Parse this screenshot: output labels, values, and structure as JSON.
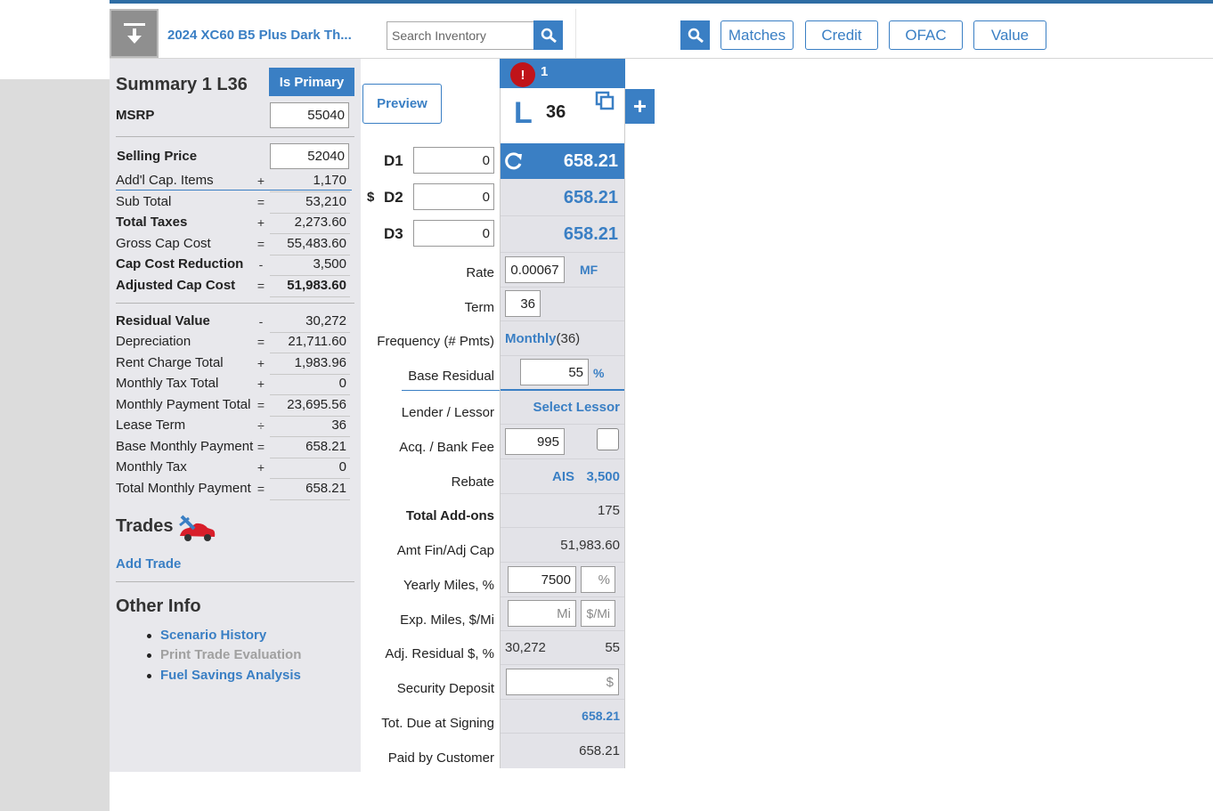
{
  "header": {
    "title": "2024 XC60 B5 Plus Dark Th...",
    "search_placeholder": "Search Inventory",
    "buttons": {
      "matches": "Matches",
      "credit": "Credit",
      "ofac": "OFAC",
      "value": "Value"
    }
  },
  "summary": {
    "title": "Summary 1 L36",
    "is_primary": "Is Primary",
    "msrp_label": "MSRP",
    "msrp_value": "55040",
    "selling_price_label": "Selling Price",
    "selling_price_value": "52040",
    "rows": [
      {
        "label": "Add'l Cap. Items",
        "op": "+",
        "value": "1,170",
        "link": false
      },
      {
        "label": "Sub Total",
        "op": "=",
        "value": "53,210",
        "link": false
      },
      {
        "label": "Total Taxes",
        "op": "+",
        "value": "2,273.60",
        "link": true
      },
      {
        "label": "Gross Cap Cost",
        "op": "=",
        "value": "55,483.60",
        "link": false
      },
      {
        "label": "Cap Cost Reduction",
        "op": "-",
        "value": "3,500",
        "link": true
      },
      {
        "label": "Adjusted Cap Cost",
        "op": "=",
        "value": "51,983.60",
        "link": true
      },
      {
        "label": "Residual Value",
        "op": "-",
        "value": "30,272",
        "link": true
      },
      {
        "label": "Depreciation",
        "op": "=",
        "value": "21,711.60",
        "link": false
      },
      {
        "label": "Rent Charge Total",
        "op": "+",
        "value": "1,983.96",
        "link": false
      },
      {
        "label": "Monthly Tax Total",
        "op": "+",
        "value": "0",
        "link": false
      },
      {
        "label": "Monthly Payment Total",
        "op": "=",
        "value": "23,695.56",
        "link": false
      },
      {
        "label": "Lease Term",
        "op": "÷",
        "value": "36",
        "link": false
      },
      {
        "label": "Base Monthly Payment",
        "op": "=",
        "value": "658.21",
        "link": false
      },
      {
        "label": "Monthly Tax",
        "op": "+",
        "value": "0",
        "link": false
      },
      {
        "label": "Total Monthly Payment",
        "op": "=",
        "value": "658.21",
        "link": false
      }
    ],
    "trades_title": "Trades",
    "add_trade": "Add Trade",
    "other_info_title": "Other Info",
    "other_info_links": [
      "Scenario History",
      "Print Trade Evaluation",
      "Fuel Savings Analysis"
    ]
  },
  "middle": {
    "preview": "Preview",
    "d1": "D1",
    "d2": "D2",
    "d3": "D3",
    "dollar": "$",
    "d1_value": "0",
    "d2_value": "0",
    "d3_value": "0",
    "labels": {
      "rate": "Rate",
      "term": "Term",
      "frequency": "Frequency (# Pmts)",
      "base_residual": "Base Residual",
      "lender": "Lender / Lessor",
      "acq_fee": "Acq. / Bank Fee",
      "rebate": "Rebate",
      "total_addons": "Total Add-ons",
      "amt_fin": "Amt Fin/Adj Cap",
      "yearly_miles": "Yearly Miles, %",
      "exp_miles": "Exp. Miles, $/Mi",
      "adj_residual": "Adj. Residual $, %",
      "security_deposit": "Security Deposit",
      "tot_due": "Tot. Due at Signing",
      "paid_by": "Paid by Customer"
    }
  },
  "column": {
    "warning_icon_text": "!",
    "number": "1",
    "lease_type": "L",
    "term": "36",
    "payments": [
      "658.21",
      "658.21",
      "658.21"
    ],
    "rate": "0.00067",
    "mf": "MF",
    "term_value": "36",
    "frequency": "Monthly",
    "frequency_count": "(36)",
    "base_residual": "55",
    "percent": "%",
    "select_lessor": "Select Lessor",
    "acq_fee": "995",
    "rebate_label": "AIS",
    "rebate_value": "3,500",
    "total_addons": "175",
    "amt_fin": "51,983.60",
    "yearly_miles": "7500",
    "yearly_pct_placeholder": "%",
    "exp_miles_placeholder": "Mi",
    "exp_permile_placeholder": "$/Mi",
    "adj_residual_value": "30,272",
    "adj_residual_pct": "55",
    "security_placeholder": "$",
    "tot_due": "658.21",
    "paid_by": "658.21"
  },
  "colors": {
    "accent": "#3a7fc4",
    "warning": "#c0141a",
    "panel": "#e8e8ec"
  }
}
